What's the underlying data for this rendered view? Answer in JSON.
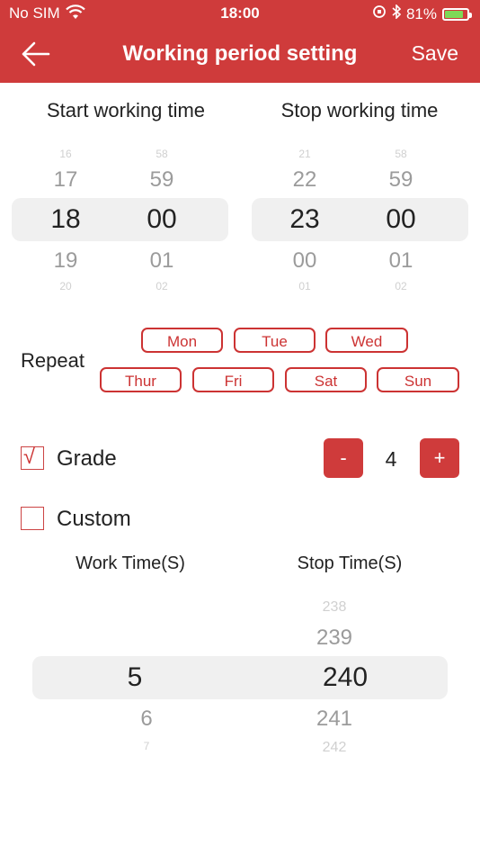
{
  "status_bar": {
    "carrier": "No SIM",
    "time": "18:00",
    "battery": "81%"
  },
  "navbar": {
    "title": "Working period setting",
    "save_label": "Save"
  },
  "start": {
    "title": "Start working time",
    "hours": {
      "far_top": "16",
      "prev": "17",
      "selected": "18",
      "next": "19",
      "far_bottom": "20"
    },
    "minutes": {
      "far_top": "58",
      "prev": "59",
      "selected": "00",
      "next": "01",
      "far_bottom": "02"
    }
  },
  "stop": {
    "title": "Stop working time",
    "hours": {
      "far_top": "21",
      "prev": "22",
      "selected": "23",
      "next": "00",
      "far_bottom": "01"
    },
    "minutes": {
      "far_top": "58",
      "prev": "59",
      "selected": "00",
      "next": "01",
      "far_bottom": "02"
    }
  },
  "repeat": {
    "label": "Repeat",
    "days": [
      "Mon",
      "Tue",
      "Wed",
      "Thur",
      "Fri",
      "Sat",
      "Sun"
    ]
  },
  "grade": {
    "label": "Grade",
    "checked": true,
    "check_glyph": "√",
    "value": "4",
    "minus": "-",
    "plus": "+"
  },
  "custom": {
    "label": "Custom",
    "checked": false
  },
  "work_time": {
    "title": "Work Time(S)",
    "selected": "5",
    "next": "6",
    "far_bottom": "7"
  },
  "stop_time": {
    "title": "Stop Time(S)",
    "far_top": "238",
    "prev": "239",
    "selected": "240",
    "next": "241",
    "far_bottom": "242"
  },
  "colors": {
    "accent": "#cf3b3b",
    "band": "#f0f0f0"
  }
}
